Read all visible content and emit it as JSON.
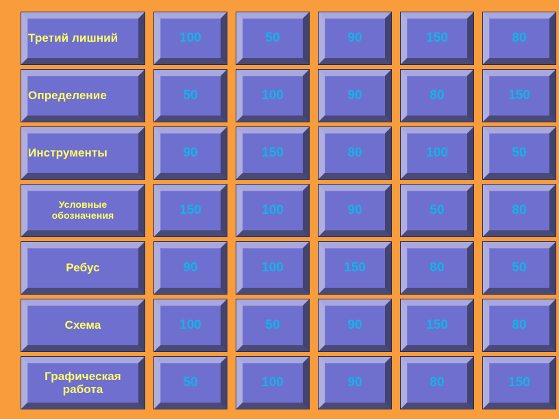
{
  "board": {
    "title": "Jeopardy Game Board",
    "background_color": "#F89C3C",
    "tile_color": "#6C6CCB",
    "category_text_color": "#FFFF66",
    "value_text_color": "#12B4E8",
    "columns": 5,
    "rows": 7,
    "rows_data": [
      {
        "category": "Третий лишний",
        "align": "left",
        "size": "normal",
        "values": [
          "100",
          "50",
          "90",
          "150",
          "80"
        ]
      },
      {
        "category": "Определение",
        "align": "left",
        "size": "normal",
        "values": [
          "50",
          "100",
          "90",
          "80",
          "150"
        ]
      },
      {
        "category": "Инструменты",
        "align": "left",
        "size": "normal",
        "values": [
          "90",
          "150",
          "80",
          "100",
          "50"
        ]
      },
      {
        "category": "Условные обозначения",
        "align": "center",
        "size": "small",
        "values": [
          "150",
          "100",
          "90",
          "50",
          "80"
        ]
      },
      {
        "category": "Ребус",
        "align": "center",
        "size": "normal",
        "values": [
          "90",
          "100",
          "150",
          "80",
          "50"
        ]
      },
      {
        "category": "Схема",
        "align": "center",
        "size": "normal",
        "values": [
          "100",
          "50",
          "90",
          "150",
          "80"
        ]
      },
      {
        "category": "Графическая работа",
        "align": "center",
        "size": "normal",
        "values": [
          "50",
          "100",
          "90",
          "80",
          "150"
        ]
      }
    ]
  }
}
